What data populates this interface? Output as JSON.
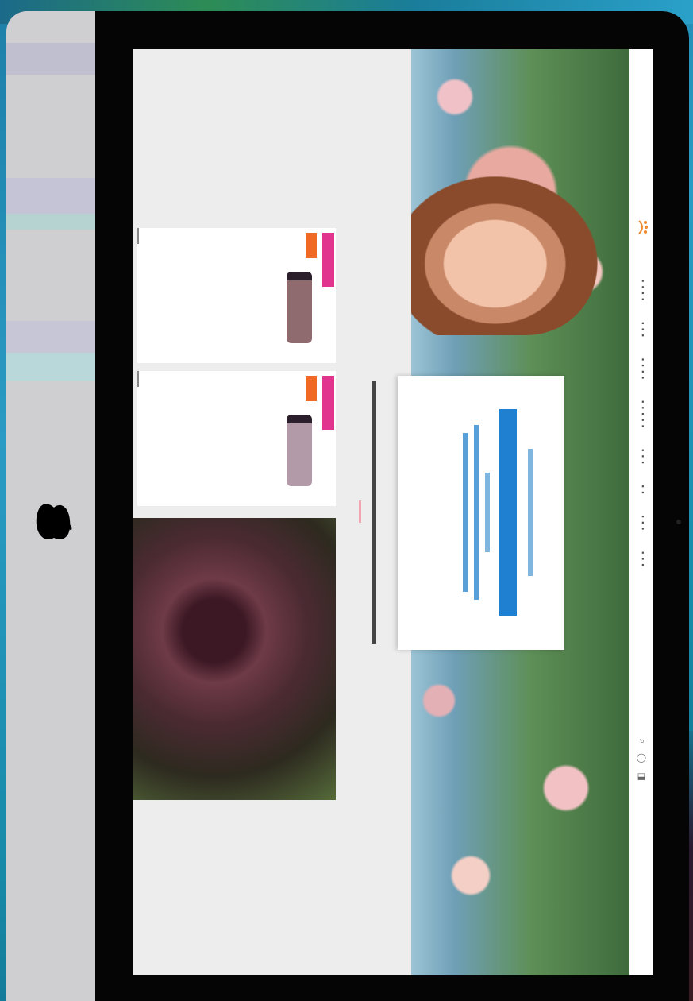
{
  "nav": {
    "links": [
      "",
      "",
      "",
      "",
      "",
      "",
      "",
      ""
    ],
    "icons": [
      "search-icon",
      "user-icon",
      "cart-icon"
    ]
  },
  "hero": {
    "kicker": "",
    "title": "",
    "subtitle": ""
  },
  "section": {
    "title": ""
  },
  "products": [
    {
      "name": "",
      "price": "",
      "old_price": ""
    },
    {
      "name": "",
      "price": "",
      "old_price": ""
    }
  ],
  "promo": {
    "title": "",
    "subtitle": ""
  },
  "colors": {
    "accent_blue": "#1f7fd0",
    "badge_pink": "#e0348e",
    "badge_orange": "#f06a25",
    "price_orange": "#f09a2b"
  }
}
